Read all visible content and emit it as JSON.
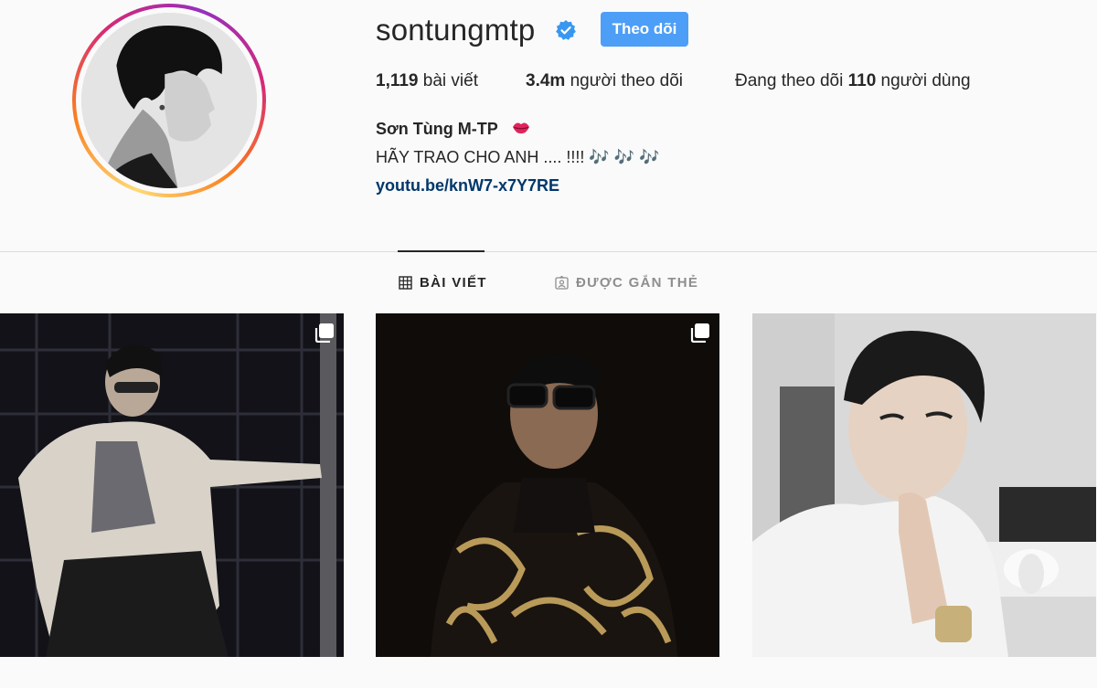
{
  "profile": {
    "username": "sontungmtp",
    "verified": true,
    "follow_label": "Theo dõi",
    "posts_count": "1,119",
    "posts_label": "bài viết",
    "followers_count": "3.4m",
    "followers_label": "người theo dõi",
    "following_prefix": "Đang theo dõi",
    "following_count": "110",
    "following_suffix": "người dùng",
    "full_name": "Sơn Tùng M-TP",
    "name_emoji": "lips-icon",
    "bio": "HÃY TRAO CHO ANH .... !!!! 🎶 🎶 🎶",
    "link": "youtu.be/knW7-x7Y7RE"
  },
  "tabs": [
    {
      "label": "BÀI VIẾT",
      "icon": "grid-icon",
      "active": true
    },
    {
      "label": "ĐƯỢC GẮN THẺ",
      "icon": "tagged-icon",
      "active": false
    }
  ],
  "posts": [
    {
      "multi": true
    },
    {
      "multi": true
    },
    {
      "multi": false
    }
  ],
  "colors": {
    "accent": "#4d9ef6",
    "link": "#00376b",
    "muted": "#8e8e8e",
    "text": "#262626",
    "background": "#fafafa"
  }
}
